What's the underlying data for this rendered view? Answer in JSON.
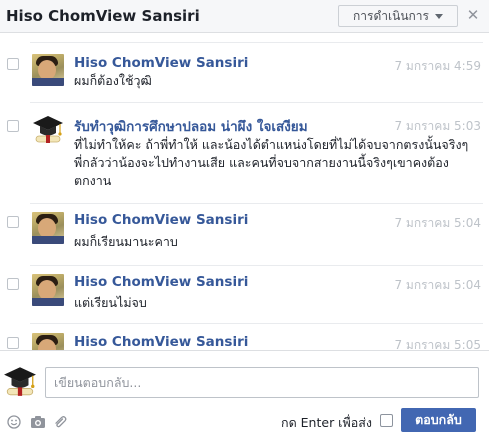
{
  "header": {
    "title": "Hiso ChomView Sansiri",
    "actions_label": "การดำเนินการ",
    "close_icon": "close-icon"
  },
  "messages": [
    {
      "sender": "Hiso ChomView Sansiri",
      "time": "7 มกราคม 4:59",
      "text": "ผมก็ต้องใช้วุฒิ",
      "avatar": "user-photo"
    },
    {
      "sender": "รับทำวุฒิการศึกษาปลอม น่าผึง ใจเสงียม",
      "time": "7 มกราคม 5:03",
      "text": "ที่ไม่ทำให้คะ ถ้าพี่ทำให้ และน้องได้ตำแหน่งโดยที่ไม่ได้จบจากตรงนั้นจริงๆพี่กลัวว่าน้องจะไปทำงานเสีย และคนที่จบจากสายงานนี้จริงๆเขาคงต้องตกงาน",
      "avatar": "graduation-cap"
    },
    {
      "sender": "Hiso ChomView Sansiri",
      "time": "7 มกราคม 5:04",
      "text": "ผมก็เรียนมานะคาบ",
      "avatar": "user-photo"
    },
    {
      "sender": "Hiso ChomView Sansiri",
      "time": "7 มกราคม 5:04",
      "text": "แต่เรียนไม่จบ",
      "avatar": "user-photo"
    },
    {
      "sender": "Hiso ChomView Sansiri",
      "time": "7 มกราคม 5:05",
      "text": "",
      "avatar": "user-photo"
    }
  ],
  "composer": {
    "placeholder": "เขียนตอบกลับ...",
    "enter_label": "กด Enter เพื่อส่ง",
    "reply_label": "ตอบกลับ",
    "icons": [
      "emoji-icon",
      "camera-icon",
      "attachment-icon"
    ]
  },
  "colors": {
    "link": "#365899",
    "button": "#4267b2",
    "timestamp": "#bec3c9"
  }
}
